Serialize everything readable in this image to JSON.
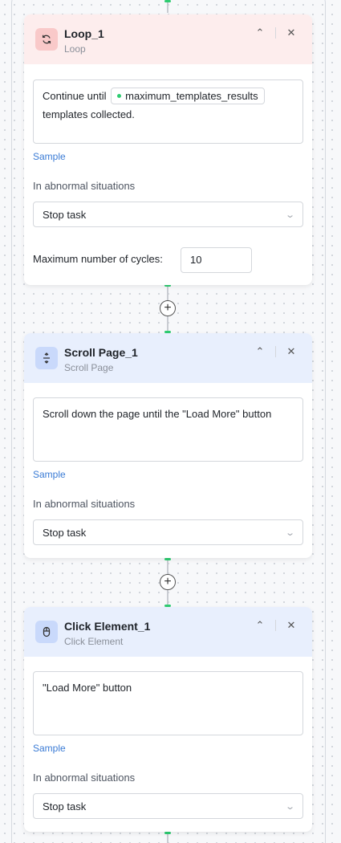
{
  "loop_node": {
    "title": "Loop_1",
    "subtitle": "Loop",
    "icon": "loop-icon",
    "condition_before": "Continue until",
    "variable": "maximum_templates_results",
    "condition_after": "templates collected.",
    "sample_label": "Sample",
    "abnormal_label": "In abnormal situations",
    "abnormal_value": "Stop task",
    "max_cycles_label": "Maximum number of cycles:",
    "max_cycles_value": "10"
  },
  "scroll_node": {
    "title": "Scroll Page_1",
    "subtitle": "Scroll Page",
    "icon": "scroll-icon",
    "prompt": "Scroll down the page  until the \"Load More\" button",
    "sample_label": "Sample",
    "abnormal_label": "In abnormal situations",
    "abnormal_value": "Stop task"
  },
  "click_node": {
    "title": "Click Element_1",
    "subtitle": "Click Element",
    "icon": "mouse-icon",
    "prompt": "\"Load More\" button",
    "sample_label": "Sample",
    "abnormal_label": "In abnormal situations",
    "abnormal_value": "Stop task"
  },
  "colors": {
    "loop_header": "#fdeded",
    "step_header": "#e8effd",
    "connector_accent": "#2ecc71",
    "link": "#3a7bd5"
  }
}
